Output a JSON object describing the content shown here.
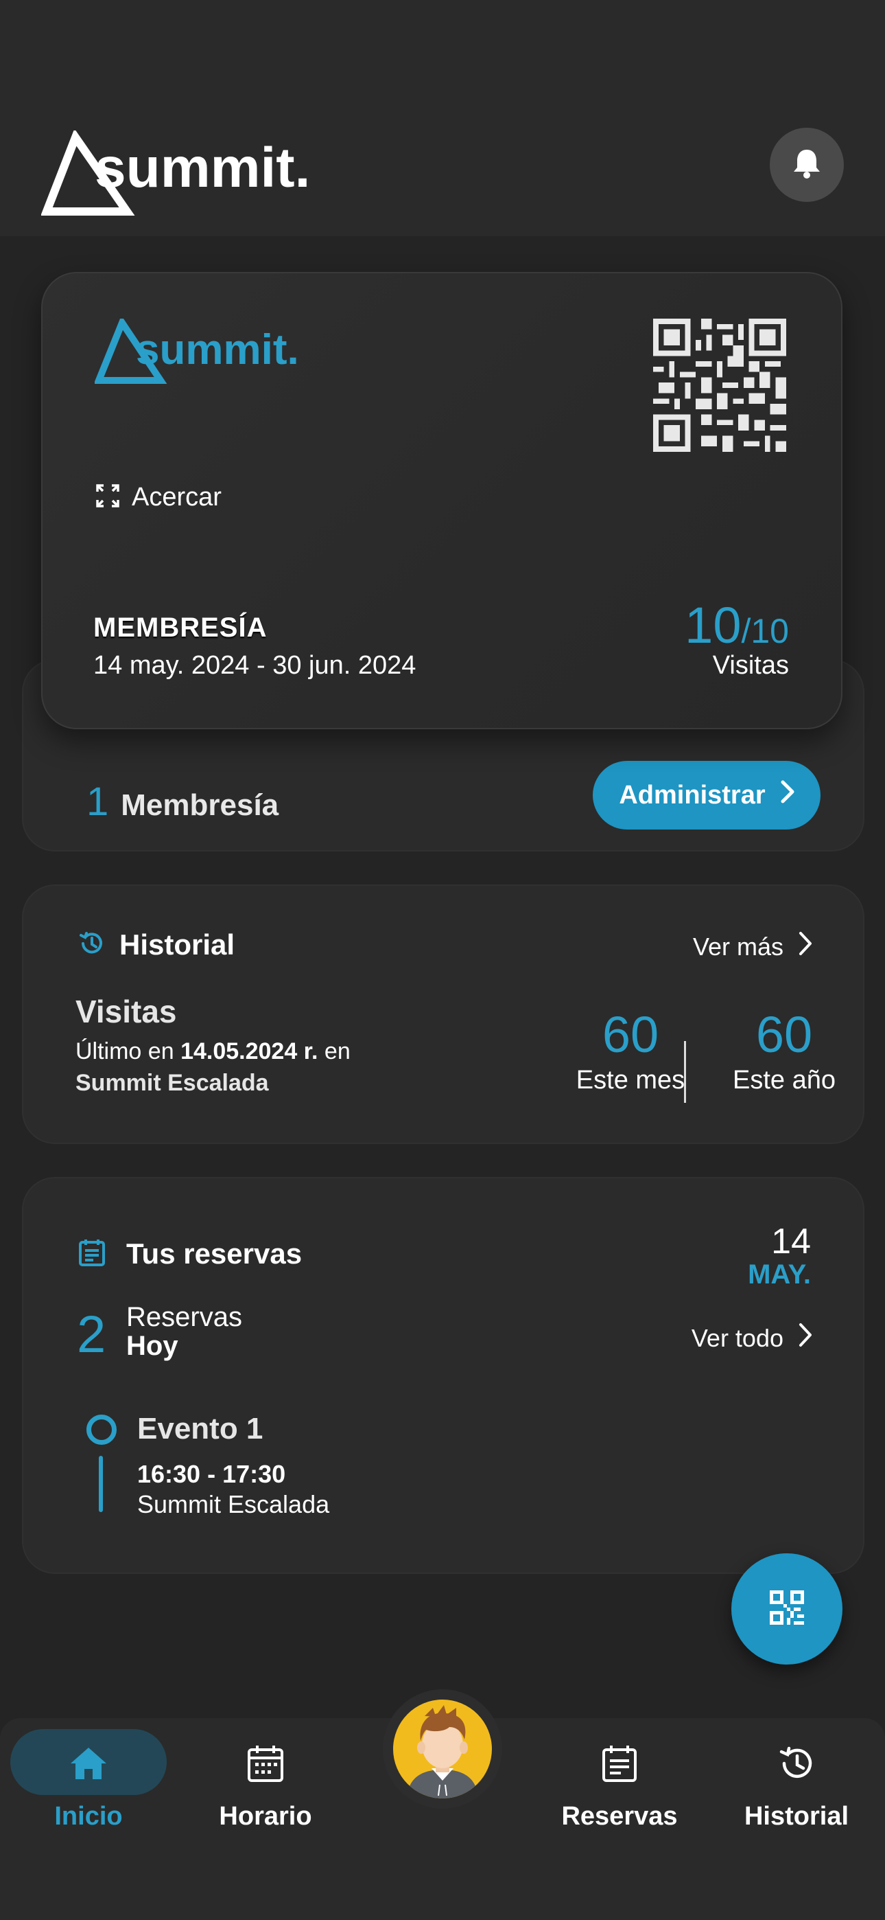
{
  "app": {
    "brand": "summit."
  },
  "header": {
    "bell_icon": "bell-icon"
  },
  "membership_card": {
    "brand": "summit.",
    "zoom_label": "Acercar",
    "title": "MEMBRESÍA",
    "dates": "14 may. 2024 - 30 jun. 2024",
    "visits_used": "10",
    "visits_total": "/10",
    "visits_label": "Visitas"
  },
  "membership_summary": {
    "count": "1",
    "label": "Membresía",
    "manage_button": "Administrar"
  },
  "history": {
    "title": "Historial",
    "more_link": "Ver más",
    "visits_title": "Visitas",
    "last_prefix": "Último en ",
    "last_date": "14.05.2024 r.",
    "last_suffix": " en",
    "gym": "Summit Escalada",
    "month_value": "60",
    "month_label": "Este mes",
    "year_value": "60",
    "year_label": "Este año"
  },
  "reservations": {
    "title": "Tus reservas",
    "day": "14",
    "month": "MAY.",
    "count": "2",
    "count_label": "Reservas",
    "count_sub": "Hoy",
    "see_all": "Ver todo",
    "event": {
      "title": "Evento 1",
      "time": "16:30 - 17:30",
      "place": "Summit Escalada"
    }
  },
  "bottom_nav": {
    "items": [
      {
        "label": "Inicio",
        "icon": "home-icon",
        "active": true
      },
      {
        "label": "Horario",
        "icon": "calendar-icon",
        "active": false
      },
      {
        "label": "Reservas",
        "icon": "reservations-icon",
        "active": false
      },
      {
        "label": "Historial",
        "icon": "history-icon",
        "active": false
      }
    ]
  },
  "colors": {
    "accent": "#2a9fc9",
    "button": "#1e95c3",
    "background": "#242424",
    "card": "#2b2b2b"
  }
}
